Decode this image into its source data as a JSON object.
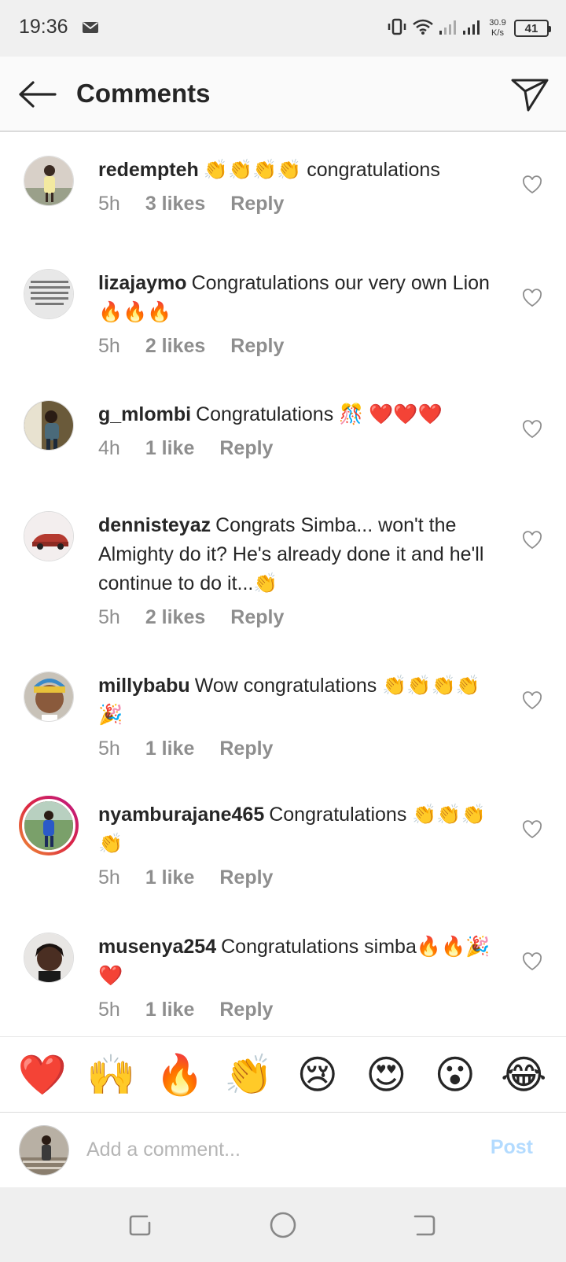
{
  "status": {
    "time": "19:36",
    "speed_value": "30.9",
    "speed_unit": "K/s",
    "battery": "41"
  },
  "header": {
    "title": "Comments"
  },
  "comments": [
    {
      "username": "redempteh",
      "text": "👏👏👏👏 congratulations",
      "time": "5h",
      "likes": "3 likes",
      "reply": "Reply"
    },
    {
      "username": "lizajaymo",
      "text": "Congratulations our very own Lion🔥🔥🔥",
      "time": "5h",
      "likes": "2 likes",
      "reply": "Reply"
    },
    {
      "username": "g_mlombi",
      "text": "Congratulations 🎊 ❤️❤️❤️",
      "time": "4h",
      "likes": "1 like",
      "reply": "Reply"
    },
    {
      "username": "dennisteyaz",
      "text": "Congrats Simba... won't the Almighty do it? He's already done it and he'll continue to do it...👏",
      "time": "5h",
      "likes": "2 likes",
      "reply": "Reply"
    },
    {
      "username": "millybabu",
      "text": "Wow congratulations 👏👏👏👏🎉",
      "time": "5h",
      "likes": "1 like",
      "reply": "Reply"
    },
    {
      "username": "nyamburajane465",
      "text": "Congratulations 👏👏👏👏",
      "time": "5h",
      "likes": "1 like",
      "reply": "Reply"
    },
    {
      "username": "musenya254",
      "text": "Congratulations simba🔥🔥🎉❤️",
      "time": "5h",
      "likes": "1 like",
      "reply": "Reply"
    }
  ],
  "emoji_bar": [
    "❤️",
    "🙌",
    "🔥",
    "👏",
    "😢",
    "😍",
    "😮",
    "😂"
  ],
  "compose": {
    "placeholder": "Add a comment...",
    "post_label": "Post"
  },
  "icons": {
    "back": "arrow-left-icon",
    "share": "paper-plane-icon",
    "like": "heart-outline-icon"
  },
  "colors": {
    "post_disabled": "#b3dbff",
    "meta_gray": "#8e8e8e",
    "story_ring": "#dc2743"
  }
}
